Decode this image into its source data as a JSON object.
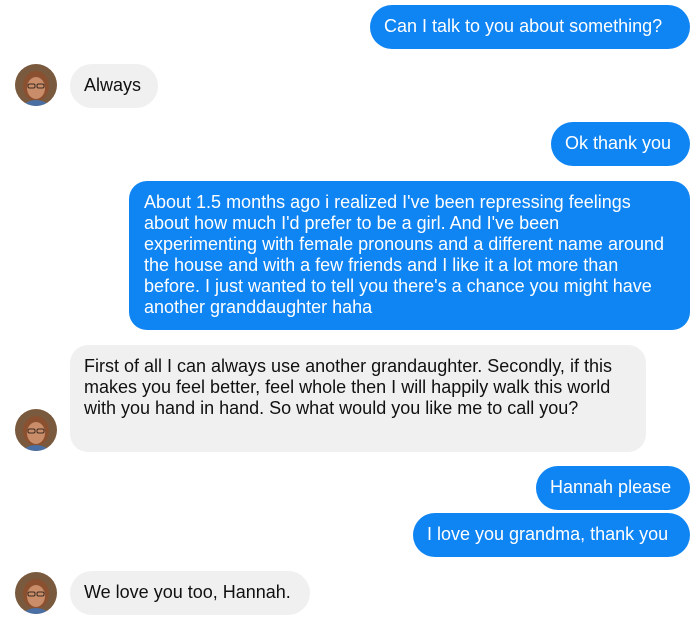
{
  "messages": [
    {
      "sender": "me",
      "text": "Can I talk to you about something?"
    },
    {
      "sender": "grandma",
      "text": "Always"
    },
    {
      "sender": "me",
      "text": "Ok thank you"
    },
    {
      "sender": "me",
      "text": "About 1.5 months ago i realized I've been repressing feelings about how much I'd prefer to be a girl. And I've been experimenting with female pronouns and a different name around the house and with a few friends and I like it a lot more than before. I just wanted to tell you there's a chance you might have another granddaughter haha"
    },
    {
      "sender": "grandma",
      "text": "First of all I can always use another grandaughter. Secondly, if this makes you feel better, feel whole then I will happily walk this world with you hand in hand. So what would you like me to call you?"
    },
    {
      "sender": "me",
      "text": "Hannah please"
    },
    {
      "sender": "me",
      "text": "I love you grandma, thank you"
    },
    {
      "sender": "grandma",
      "text": "We love you too, Hannah."
    }
  ],
  "colors": {
    "outgoing_bubble": "#0f84f3",
    "incoming_bubble": "#f0f0f1"
  },
  "icons": {
    "contact_avatar": "avatar-photo"
  }
}
